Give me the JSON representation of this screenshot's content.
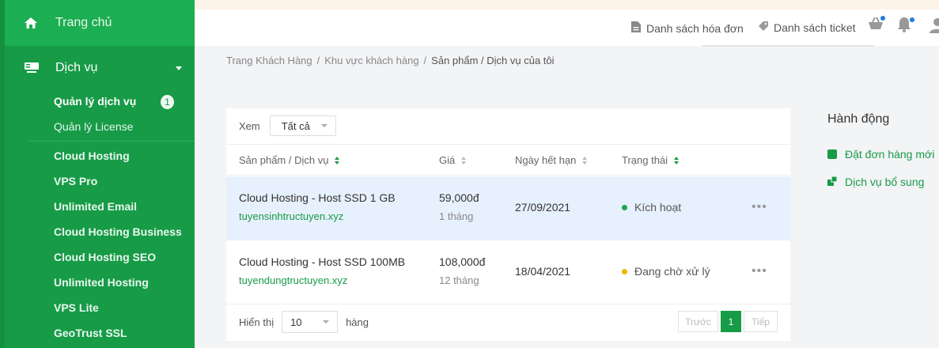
{
  "sidebar": {
    "home_label": "Trang chủ",
    "service_label": "Dịch vụ",
    "sub_active": "Quản lý dịch vụ",
    "sub_active_badge": "1",
    "sub_license": "Quản lý License",
    "products": [
      "Cloud Hosting",
      "VPS Pro",
      "Unlimited Email",
      "Cloud Hosting Business",
      "Cloud Hosting SEO",
      "Unlimited Hosting",
      "VPS Lite",
      "GeoTrust SSL"
    ]
  },
  "header": {
    "invoices_label": "Danh sách hóa đơn",
    "tickets_label": "Danh sách ticket"
  },
  "breadcrumb": {
    "items": [
      "Trang Khách Hàng",
      "Khu vực khách hàng"
    ],
    "current": "Sản phẩm / Dịch vụ của tôi",
    "separator": "/"
  },
  "filter": {
    "label": "Xem",
    "value": "Tất cả"
  },
  "table": {
    "columns": [
      "Sản phẩm / Dịch vụ",
      "Giá",
      "Ngày hết hạn",
      "Trạng thái"
    ],
    "rows": [
      {
        "product": "Cloud Hosting - Host SSD 1 GB",
        "domain": "tuyensinhtructuyen.xyz",
        "price": "59,000đ",
        "period": "1 tháng",
        "expiry": "27/09/2021",
        "status": "Kích hoạt",
        "status_color": "#1aa84f",
        "more": "•••"
      },
      {
        "product": "Cloud Hosting - Host SSD 100MB",
        "domain": "tuyendungtructuyen.xyz",
        "price": "108,000đ",
        "period": "12 tháng",
        "expiry": "18/04/2021",
        "status": "Đang chờ xử lý",
        "status_color": "#f5b400",
        "more": "•••"
      }
    ]
  },
  "footer": {
    "show_label": "Hiển thị",
    "page_size": "10",
    "rows_label": "hàng",
    "prev_label": "Trước",
    "page": "1",
    "next_label": "Tiếp"
  },
  "actions": {
    "title": "Hành động",
    "order_label": "Đặt đơn hàng mới",
    "addon_label": "Dịch vụ bổ sung"
  },
  "colors": {
    "brand_green": "#179b47",
    "active_row": "#e7f0fd"
  }
}
